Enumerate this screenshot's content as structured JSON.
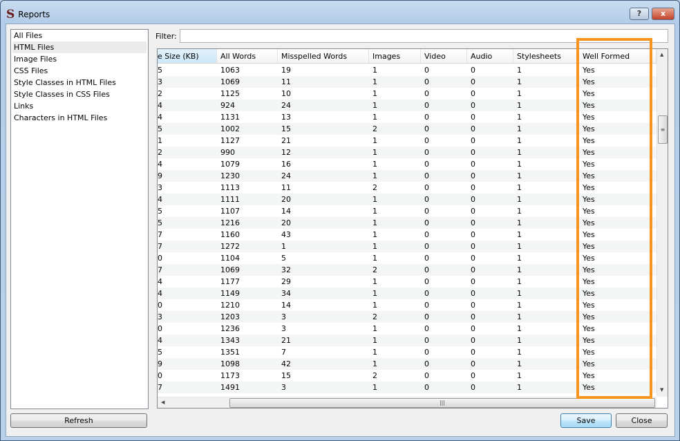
{
  "window": {
    "title": "Reports",
    "help": "?",
    "close": "x"
  },
  "sidebar": {
    "items": [
      "All Files",
      "HTML Files",
      "Image Files",
      "CSS Files",
      "Style Classes in HTML Files",
      "Style Classes in CSS Files",
      "Links",
      "Characters in HTML Files"
    ],
    "selected": "HTML Files"
  },
  "filter": {
    "label": "Filter:",
    "value": ""
  },
  "table": {
    "columns": [
      "e Size (KB)",
      "All Words",
      "Misspelled Words",
      "Images",
      "Video",
      "Audio",
      "Stylesheets",
      "Well Formed"
    ],
    "sorted_column": "e Size (KB)",
    "rows": [
      [
        "5",
        "1063",
        "19",
        "1",
        "0",
        "0",
        "1",
        "Yes"
      ],
      [
        "3",
        "1069",
        "11",
        "1",
        "0",
        "0",
        "1",
        "Yes"
      ],
      [
        "2",
        "1125",
        "10",
        "1",
        "0",
        "0",
        "1",
        "Yes"
      ],
      [
        "4",
        "924",
        "24",
        "1",
        "0",
        "0",
        "1",
        "Yes"
      ],
      [
        "4",
        "1131",
        "13",
        "1",
        "0",
        "0",
        "1",
        "Yes"
      ],
      [
        "5",
        "1002",
        "15",
        "2",
        "0",
        "0",
        "1",
        "Yes"
      ],
      [
        "1",
        "1127",
        "21",
        "1",
        "0",
        "0",
        "1",
        "Yes"
      ],
      [
        "2",
        "990",
        "12",
        "1",
        "0",
        "0",
        "1",
        "Yes"
      ],
      [
        "4",
        "1079",
        "16",
        "1",
        "0",
        "0",
        "1",
        "Yes"
      ],
      [
        "9",
        "1230",
        "24",
        "1",
        "0",
        "0",
        "1",
        "Yes"
      ],
      [
        "3",
        "1113",
        "11",
        "2",
        "0",
        "0",
        "1",
        "Yes"
      ],
      [
        "4",
        "1111",
        "20",
        "1",
        "0",
        "0",
        "1",
        "Yes"
      ],
      [
        "5",
        "1107",
        "14",
        "1",
        "0",
        "0",
        "1",
        "Yes"
      ],
      [
        "5",
        "1216",
        "20",
        "1",
        "0",
        "0",
        "1",
        "Yes"
      ],
      [
        "7",
        "1160",
        "43",
        "1",
        "0",
        "0",
        "1",
        "Yes"
      ],
      [
        "7",
        "1272",
        "1",
        "1",
        "0",
        "0",
        "1",
        "Yes"
      ],
      [
        "0",
        "1104",
        "5",
        "1",
        "0",
        "0",
        "1",
        "Yes"
      ],
      [
        "7",
        "1069",
        "32",
        "2",
        "0",
        "0",
        "1",
        "Yes"
      ],
      [
        "4",
        "1177",
        "29",
        "1",
        "0",
        "0",
        "1",
        "Yes"
      ],
      [
        "4",
        "1149",
        "34",
        "1",
        "0",
        "0",
        "1",
        "Yes"
      ],
      [
        "0",
        "1210",
        "14",
        "1",
        "0",
        "0",
        "1",
        "Yes"
      ],
      [
        "3",
        "1203",
        "3",
        "2",
        "0",
        "0",
        "1",
        "Yes"
      ],
      [
        "0",
        "1236",
        "3",
        "1",
        "0",
        "0",
        "1",
        "Yes"
      ],
      [
        "4",
        "1343",
        "21",
        "1",
        "0",
        "0",
        "1",
        "Yes"
      ],
      [
        "5",
        "1351",
        "7",
        "1",
        "0",
        "0",
        "1",
        "Yes"
      ],
      [
        "9",
        "1098",
        "42",
        "1",
        "0",
        "0",
        "1",
        "Yes"
      ],
      [
        "0",
        "1173",
        "15",
        "2",
        "0",
        "0",
        "1",
        "Yes"
      ],
      [
        "7",
        "1491",
        "3",
        "1",
        "0",
        "0",
        "1",
        "Yes"
      ]
    ]
  },
  "buttons": {
    "refresh": "Refresh",
    "save": "Save",
    "close": "Close"
  },
  "highlight": {
    "column": "Well Formed",
    "color": "#f7941d"
  }
}
